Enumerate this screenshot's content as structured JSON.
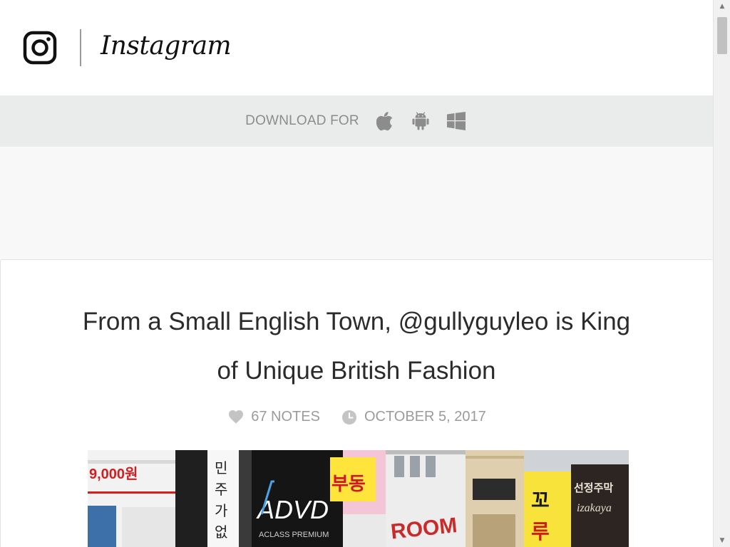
{
  "header": {
    "brand_name": "Instagram",
    "logo_icon": "instagram-camera-icon"
  },
  "download_bar": {
    "label": "DOWNLOAD FOR",
    "platforms": [
      {
        "name": "iOS",
        "icon": "apple-icon"
      },
      {
        "name": "Android",
        "icon": "android-icon"
      },
      {
        "name": "Windows",
        "icon": "windows-icon"
      }
    ]
  },
  "post": {
    "title": "From a Small English Town, @gullyguyleo is King of Unique British Fashion",
    "notes": "67 NOTES",
    "date": "OCTOBER 5, 2017",
    "notes_icon": "heart-icon",
    "date_icon": "clock-icon",
    "image": {
      "signs": [
        "9,000원",
        "ADVD",
        "ACLASS PREMIUM",
        "ROOM",
        "izakaya"
      ]
    }
  },
  "colors": {
    "header_bg": "#ffffff",
    "download_bar_bg": "#eaebeb",
    "page_bg": "#f8f8f8",
    "title_text": "#2b2b2b",
    "meta_text": "#9b9b9b"
  }
}
